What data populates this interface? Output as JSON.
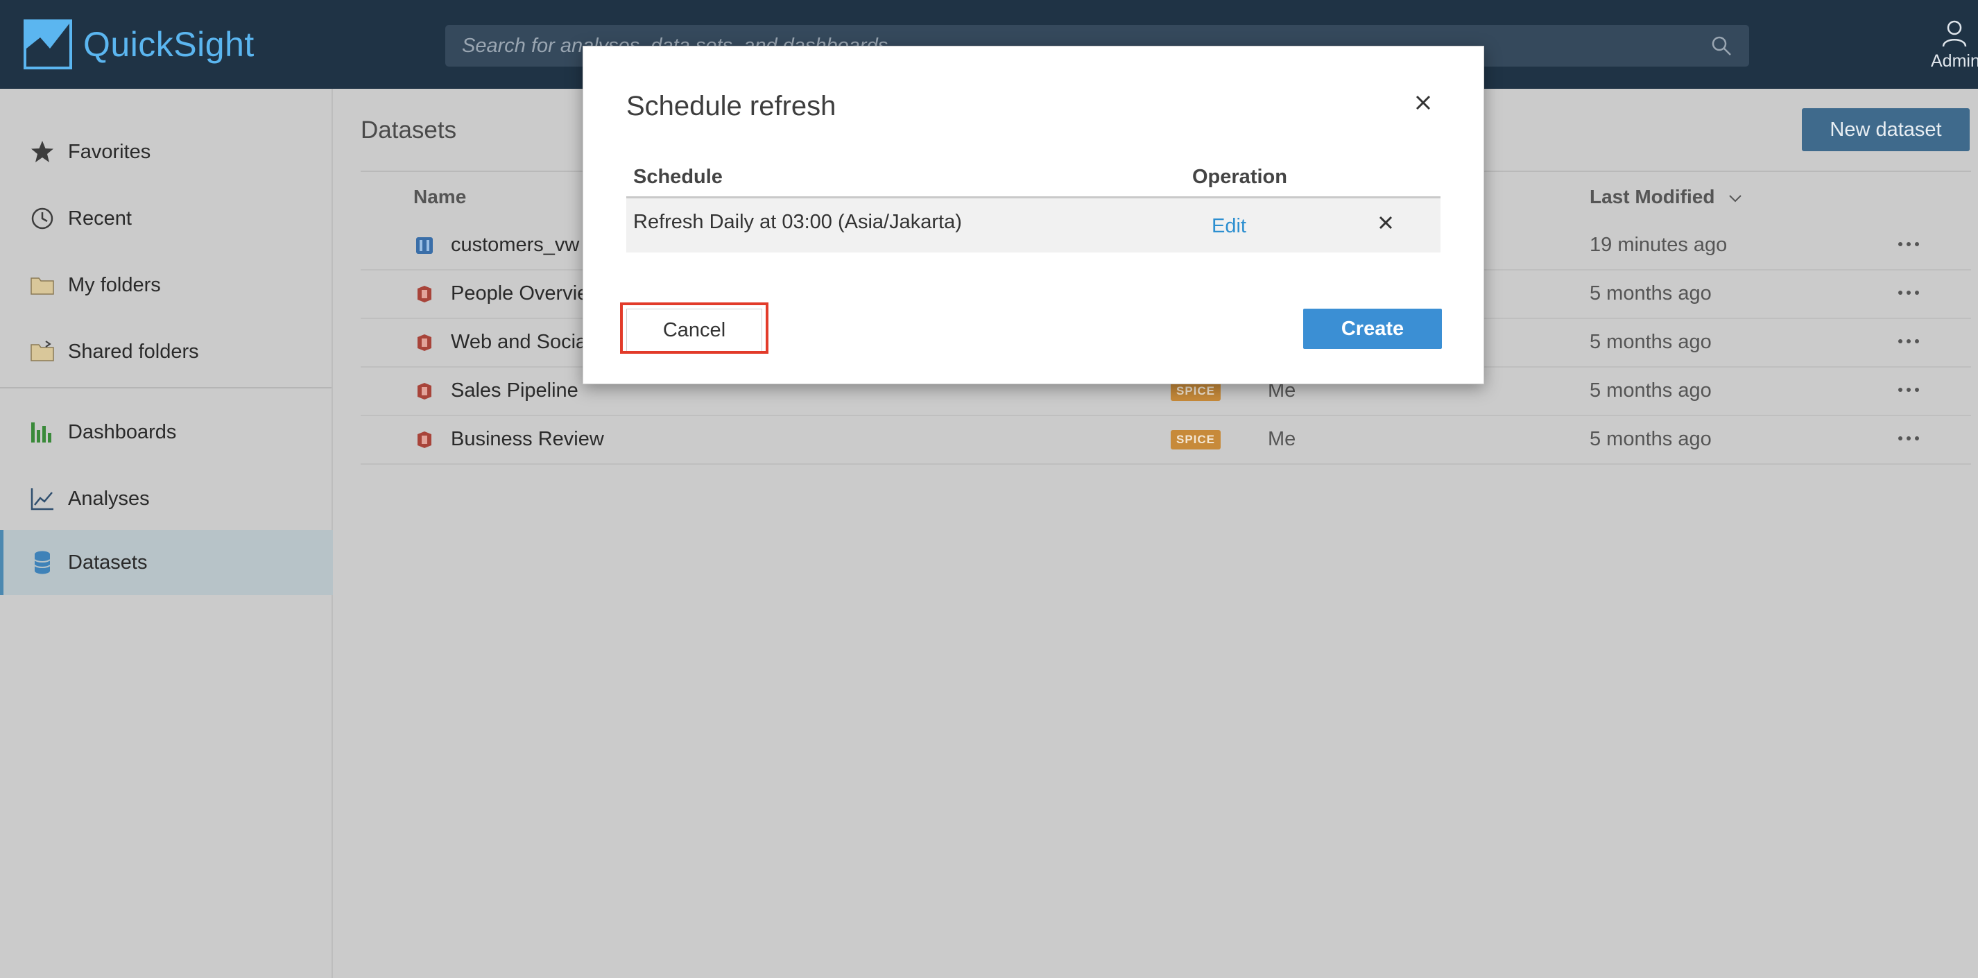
{
  "app": {
    "name": "QuickSight",
    "search_placeholder": "Search for analyses, data sets, and dashboards",
    "user_label": "Admin"
  },
  "sidebar": {
    "items": [
      {
        "label": "Favorites",
        "icon": "star-icon"
      },
      {
        "label": "Recent",
        "icon": "clock-icon"
      },
      {
        "label": "My folders",
        "icon": "folder-icon"
      },
      {
        "label": "Shared folders",
        "icon": "shared-folder-icon"
      },
      {
        "label": "Dashboards",
        "icon": "bar-chart-icon"
      },
      {
        "label": "Analyses",
        "icon": "line-chart-icon"
      },
      {
        "label": "Datasets",
        "icon": "database-icon",
        "active": true
      }
    ]
  },
  "main": {
    "title": "Datasets",
    "new_button": "New dataset",
    "columns": {
      "name": "Name",
      "last_modified": "Last Modified"
    },
    "rows": [
      {
        "name": "customers_vw",
        "type": "redshift",
        "badge": "",
        "owner": "",
        "modified": "19 minutes ago"
      },
      {
        "name": "People Overview",
        "type": "s3",
        "badge": "",
        "owner": "",
        "modified": "5 months ago"
      },
      {
        "name": "Web and Social Media Analytics",
        "type": "s3",
        "badge": "",
        "owner": "",
        "modified": "5 months ago"
      },
      {
        "name": "Sales Pipeline",
        "type": "s3",
        "badge": "SPICE",
        "owner": "Me",
        "modified": "5 months ago"
      },
      {
        "name": "Business Review",
        "type": "s3",
        "badge": "SPICE",
        "owner": "Me",
        "modified": "5 months ago"
      }
    ]
  },
  "modal": {
    "title": "Schedule refresh",
    "col_schedule": "Schedule",
    "col_operation": "Operation",
    "schedule_text": "Refresh Daily at 03:00 (Asia/Jakarta)",
    "edit_label": "Edit",
    "cancel_label": "Cancel",
    "create_label": "Create"
  },
  "colors": {
    "topbar": "#1f3345",
    "brand": "#5bb6f0",
    "primary_button": "#3b8fd4",
    "highlight": "#e23b2a",
    "spice_badge": "#c78a3a"
  }
}
